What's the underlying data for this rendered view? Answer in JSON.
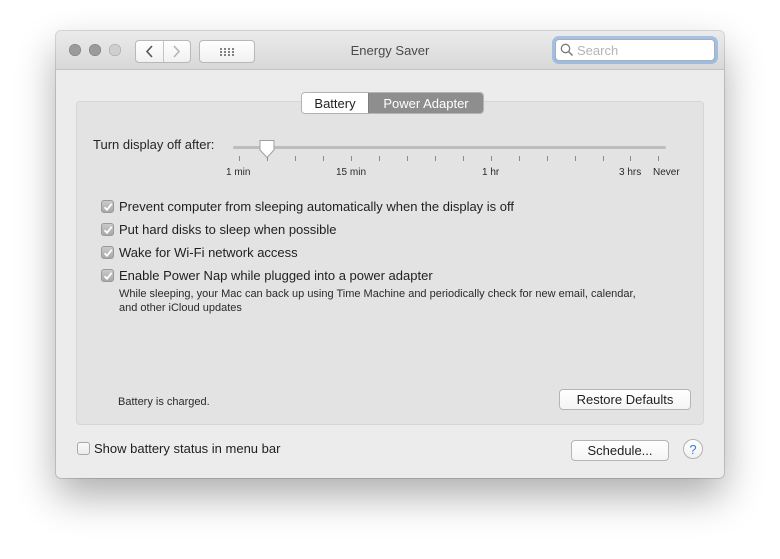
{
  "window": {
    "title": "Energy Saver",
    "search_placeholder": "Search"
  },
  "tabs": [
    {
      "label": "Battery",
      "selected": false
    },
    {
      "label": "Power Adapter",
      "selected": true
    }
  ],
  "slider": {
    "label": "Turn display off after:",
    "value": "2 min",
    "tick_labels": [
      "1 min",
      "15 min",
      "1 hr",
      "3 hrs",
      "Never"
    ]
  },
  "options": [
    {
      "label": "Prevent computer from sleeping automatically when the display is off",
      "checked": true
    },
    {
      "label": "Put hard disks to sleep when possible",
      "checked": true
    },
    {
      "label": "Wake for Wi-Fi network access",
      "checked": true
    },
    {
      "label": "Enable Power Nap while plugged into a power adapter",
      "checked": true
    }
  ],
  "power_nap_note": "While sleeping, your Mac can back up using Time Machine and periodically check for new email, calendar, and other iCloud updates",
  "battery_status": "Battery is charged.",
  "restore_defaults_label": "Restore Defaults",
  "show_battery_status": {
    "label": "Show battery status in menu bar",
    "checked": false
  },
  "schedule_label": "Schedule...",
  "help_label": "?"
}
